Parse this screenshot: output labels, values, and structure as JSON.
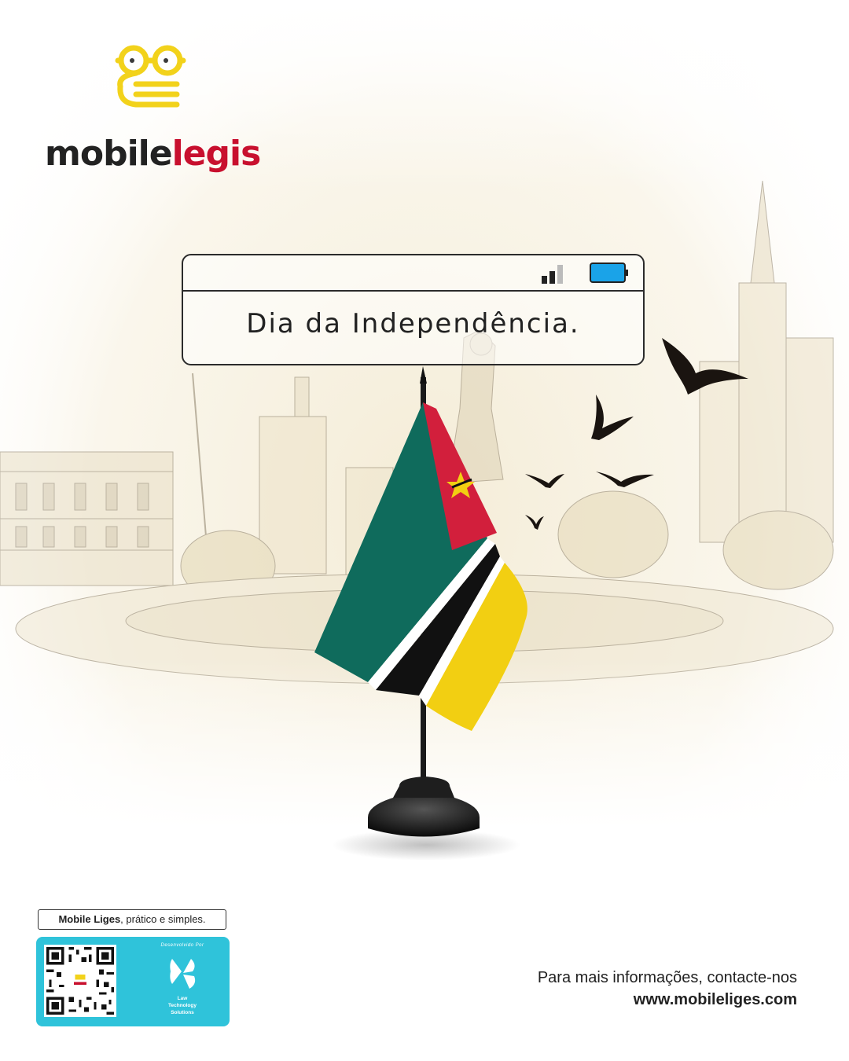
{
  "brand": {
    "name_part1": "mobile",
    "name_part2": "legis",
    "logo_color": "#f2d21b",
    "accent_color": "#c8102e"
  },
  "headline": {
    "text": "Dia da Independência."
  },
  "status_bar": {
    "signal_icon": "signal-bars-icon",
    "battery_icon": "battery-icon",
    "battery_color": "#1aa3e8"
  },
  "flag": {
    "colors": {
      "green": "#0f6b5c",
      "black": "#111111",
      "yellow": "#f2cf12",
      "red": "#d21f3c",
      "white": "#ffffff"
    }
  },
  "footer": {
    "tagline_bold": "Mobile Liges",
    "tagline_rest": ", prático e simples.",
    "developed_by": "Desenvolvido Por",
    "developer_line1": "Law",
    "developer_line2": "Technology",
    "developer_line3": "Solutions",
    "contact_text": "Para mais informações, contacte-nos",
    "website": "www.mobileliges.com",
    "card_color": "#2fc3da"
  }
}
